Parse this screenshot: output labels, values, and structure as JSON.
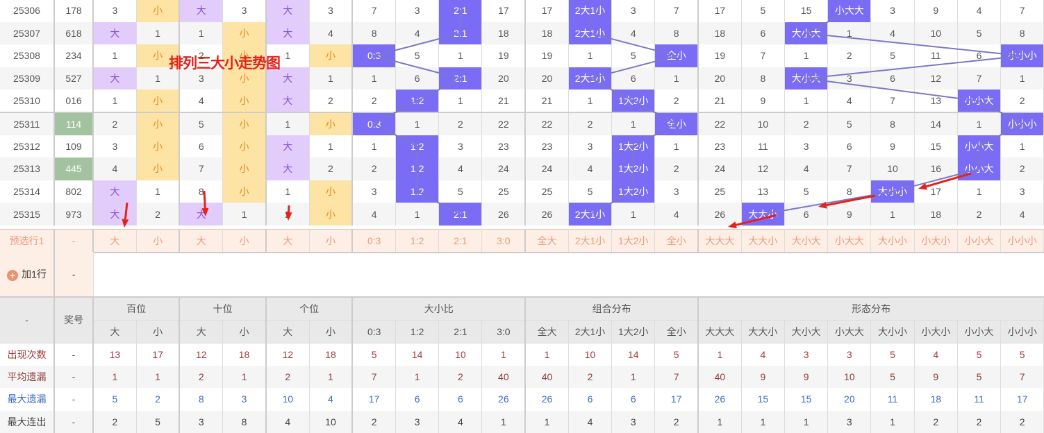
{
  "title": "排列三大小走势图",
  "colors": {
    "big": "#e2ccfb",
    "small": "#fde3a4",
    "hit": "#7b6cf6",
    "prize": "#a3c29f",
    "line": "#7b78c8",
    "arrow": "#e4221c"
  },
  "rows": [
    {
      "issue": "25306",
      "num": "178",
      "cells": [
        "3",
        "小",
        "大",
        "3",
        "大",
        "3",
        "7",
        "3",
        "2:1",
        "17",
        "17",
        "2大1小",
        "3",
        "7",
        "17",
        "5",
        "15",
        "小大大",
        "3",
        "9",
        "4",
        "7"
      ]
    },
    {
      "issue": "25307",
      "num": "618",
      "cells": [
        "大",
        "1",
        "1",
        "小",
        "大",
        "4",
        "8",
        "4",
        "2:1",
        "18",
        "18",
        "2大1小",
        "4",
        "8",
        "18",
        "6",
        "大小大",
        "1",
        "4",
        "10",
        "5",
        "8"
      ]
    },
    {
      "issue": "25308",
      "num": "234",
      "cells": [
        "1",
        "小",
        "2",
        "小",
        "1",
        "小",
        "0:3",
        "5",
        "1",
        "19",
        "19",
        "1",
        "5",
        "全小",
        "19",
        "7",
        "1",
        "2",
        "5",
        "11",
        "6",
        "小小小"
      ]
    },
    {
      "issue": "25309",
      "num": "527",
      "cells": [
        "大",
        "1",
        "3",
        "小",
        "大",
        "1",
        "1",
        "6",
        "2:1",
        "20",
        "20",
        "2大1小",
        "6",
        "1",
        "20",
        "8",
        "大小大",
        "3",
        "6",
        "12",
        "7",
        "1"
      ]
    },
    {
      "issue": "25310",
      "num": "016",
      "cells": [
        "1",
        "小",
        "4",
        "小",
        "大",
        "2",
        "2",
        "1:2",
        "1",
        "21",
        "21",
        "1",
        "1大2小",
        "2",
        "21",
        "9",
        "1",
        "4",
        "7",
        "13",
        "小小大",
        "2"
      ]
    },
    {
      "issue": "25311",
      "num": "114",
      "prize": true,
      "cells": [
        "2",
        "小",
        "5",
        "小",
        "1",
        "小",
        "0:3",
        "1",
        "2",
        "22",
        "22",
        "2",
        "1",
        "全小",
        "22",
        "10",
        "2",
        "5",
        "8",
        "14",
        "1",
        "小小小"
      ]
    },
    {
      "issue": "25312",
      "num": "109",
      "cells": [
        "3",
        "小",
        "6",
        "小",
        "大",
        "1",
        "1",
        "1:2",
        "3",
        "23",
        "23",
        "3",
        "1大2小",
        "1",
        "23",
        "11",
        "3",
        "6",
        "9",
        "15",
        "小小大",
        "1"
      ]
    },
    {
      "issue": "25313",
      "num": "445",
      "prize": true,
      "cells": [
        "4",
        "小",
        "7",
        "小",
        "大",
        "2",
        "2",
        "1:2",
        "4",
        "24",
        "24",
        "4",
        "1大2小",
        "2",
        "24",
        "12",
        "4",
        "7",
        "10",
        "16",
        "小小大",
        "2"
      ]
    },
    {
      "issue": "25314",
      "num": "802",
      "cells": [
        "大",
        "1",
        "8",
        "小",
        "1",
        "小",
        "3",
        "1:2",
        "5",
        "25",
        "25",
        "5",
        "1大2小",
        "3",
        "25",
        "13",
        "5",
        "8",
        "大小小",
        "17",
        "1",
        "3"
      ]
    },
    {
      "issue": "25315",
      "num": "973",
      "cells": [
        "大",
        "2",
        "大",
        "1",
        "2",
        "小",
        "4",
        "1",
        "2:1",
        "26",
        "26",
        "2大1小",
        "1",
        "4",
        "26",
        "大大小",
        "6",
        "9",
        "1",
        "18",
        "2",
        "4"
      ]
    }
  ],
  "preselect": {
    "label": "预选行1",
    "num": "-",
    "cells": [
      "大",
      "小",
      "大",
      "小",
      "大",
      "小",
      "0:3",
      "1:2",
      "2:1",
      "3:0",
      "全大",
      "2大1小",
      "1大2小",
      "全小",
      "大大大",
      "大大小",
      "大小大",
      "小大大",
      "大小小",
      "小大小",
      "小小大",
      "小小小"
    ]
  },
  "add_row": {
    "label": "加1行",
    "num": "-"
  },
  "header": {
    "corner": "-",
    "num": "奖号",
    "groups": [
      "百位",
      "十位",
      "个位",
      "大小比",
      "组合分布",
      "形态分布"
    ],
    "subs": [
      "大",
      "小",
      "大",
      "小",
      "大",
      "小",
      "0:3",
      "1:2",
      "2:1",
      "3:0",
      "全大",
      "2大1小",
      "1大2小",
      "全小",
      "大大大",
      "大大小",
      "大小大",
      "小大大",
      "大小小",
      "小大小",
      "小小大",
      "小小小"
    ]
  },
  "stats": [
    {
      "label": "出现次数",
      "num": "-",
      "values": [
        "13",
        "17",
        "12",
        "18",
        "12",
        "18",
        "5",
        "14",
        "10",
        "1",
        "1",
        "10",
        "14",
        "5",
        "1",
        "4",
        "3",
        "3",
        "5",
        "4",
        "5",
        "5"
      ]
    },
    {
      "label": "平均遗漏",
      "num": "-",
      "values": [
        "1",
        "1",
        "2",
        "1",
        "2",
        "1",
        "7",
        "1",
        "2",
        "40",
        "40",
        "2",
        "1",
        "7",
        "40",
        "9",
        "9",
        "10",
        "5",
        "9",
        "5",
        "7"
      ]
    },
    {
      "label": "最大遗漏",
      "num": "-",
      "values": [
        "5",
        "2",
        "8",
        "3",
        "10",
        "4",
        "17",
        "6",
        "6",
        "26",
        "26",
        "6",
        "6",
        "17",
        "26",
        "15",
        "15",
        "20",
        "11",
        "18",
        "11",
        "17"
      ]
    },
    {
      "label": "最大连出",
      "num": "-",
      "values": [
        "2",
        "5",
        "3",
        "8",
        "4",
        "10",
        "2",
        "3",
        "4",
        "1",
        "1",
        "4",
        "3",
        "2",
        "1",
        "1",
        "1",
        "3",
        "1",
        "2",
        "2",
        "2"
      ]
    }
  ]
}
